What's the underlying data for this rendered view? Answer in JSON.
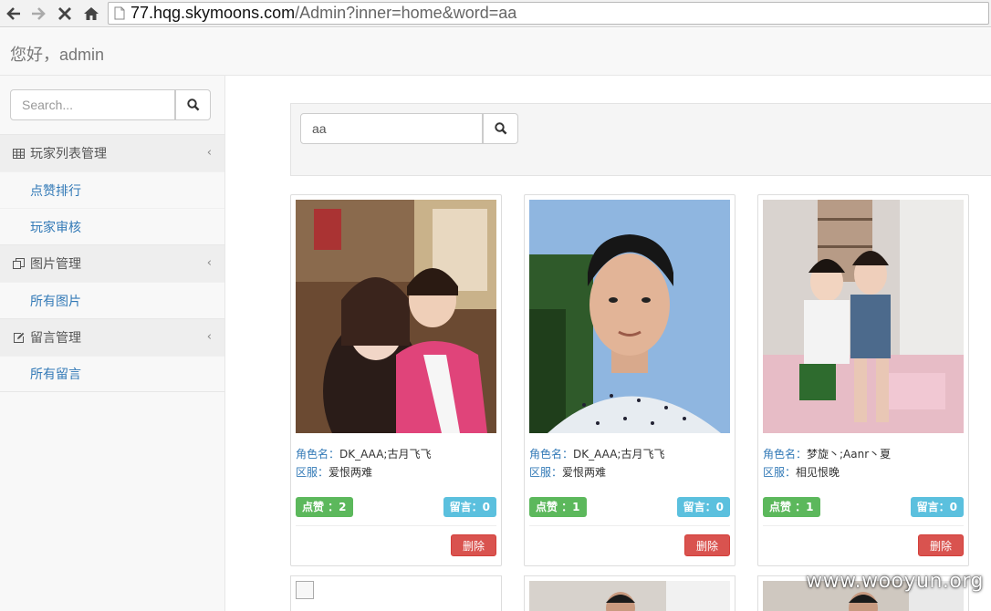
{
  "browser": {
    "url_host": "77.hqg.skymoons.com",
    "url_path": "/Admin?inner=home&word=aa"
  },
  "header": {
    "greeting": "您好，admin"
  },
  "sidebar": {
    "search_placeholder": "Search...",
    "groups": [
      {
        "label": "玩家列表管理",
        "icon": "table-icon",
        "items": [
          "点赞排行",
          "玩家审核"
        ]
      },
      {
        "label": "图片管理",
        "icon": "images-icon",
        "items": [
          "所有图片"
        ]
      },
      {
        "label": "留言管理",
        "icon": "edit-icon",
        "items": [
          "所有留言"
        ]
      }
    ]
  },
  "main": {
    "search_value": "aa",
    "cards": [
      {
        "role_key": "角色名：",
        "role": "DK_AAA;古月飞飞",
        "server_key": "区服：",
        "server": "爱恨两难",
        "likes": "点赞 ：2",
        "messages": "留言：0",
        "delete": "删除"
      },
      {
        "role_key": "角色名：",
        "role": "DK_AAA;古月飞飞",
        "server_key": "区服：",
        "server": "爱恨两难",
        "likes": "点赞 ：1",
        "messages": "留言：0",
        "delete": "删除"
      },
      {
        "role_key": "角色名：",
        "role": "梦旋丶;Aanr丶夏",
        "server_key": "区服：",
        "server": "相见恨晚",
        "likes": "点赞 ：1",
        "messages": "留言：0",
        "delete": "删除"
      }
    ]
  },
  "watermark": "www.wooyun.org",
  "colors": {
    "link": "#337ab7",
    "like_badge": "#5cb85c",
    "message_badge": "#5bc0de",
    "delete_button": "#d9534f"
  }
}
